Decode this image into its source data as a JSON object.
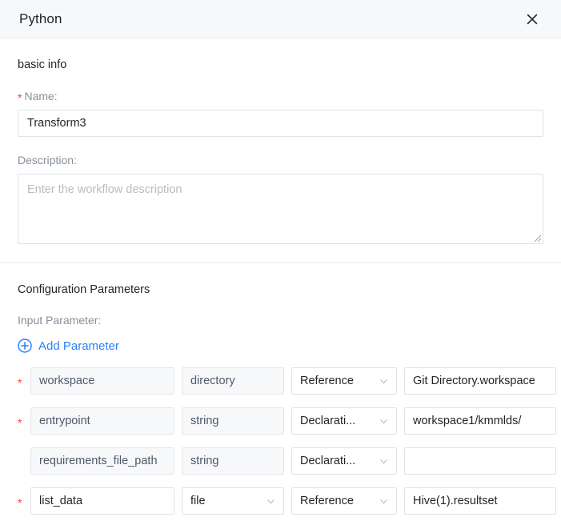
{
  "header": {
    "title": "Python",
    "close_label": "×"
  },
  "basic_info": {
    "section_title": "basic info",
    "name": {
      "label": "Name:",
      "required_mark": "*",
      "value": "Transform3"
    },
    "description": {
      "label": "Description:",
      "value": "",
      "placeholder": "Enter the workflow description"
    }
  },
  "config": {
    "section_title": "Configuration Parameters",
    "input_parameter_label": "Input Parameter:",
    "add_parameter_label": "Add Parameter",
    "accent_color": "#2b7fff",
    "required_color": "#f53f3f",
    "rows": [
      {
        "required": true,
        "required_mark": "*",
        "name": "workspace",
        "name_disabled": true,
        "type": "directory",
        "type_disabled": true,
        "type_has_chevron": false,
        "mode": "Reference",
        "mode_has_chevron": true,
        "value": "Git Directory.workspace"
      },
      {
        "required": true,
        "required_mark": "*",
        "name": "entrypoint",
        "name_disabled": true,
        "type": "string",
        "type_disabled": true,
        "type_has_chevron": false,
        "mode": "Declarati...",
        "mode_has_chevron": true,
        "value": "workspace1/kmmlds/"
      },
      {
        "required": false,
        "required_mark": "",
        "name": "requirements_file_path",
        "name_disabled": true,
        "type": "string",
        "type_disabled": true,
        "type_has_chevron": false,
        "mode": "Declarati...",
        "mode_has_chevron": true,
        "value": ""
      },
      {
        "required": true,
        "required_mark": "*",
        "name": "list_data",
        "name_disabled": false,
        "type": "file",
        "type_disabled": false,
        "type_has_chevron": true,
        "mode": "Reference",
        "mode_has_chevron": true,
        "value": "Hive(1).resultset"
      }
    ]
  }
}
